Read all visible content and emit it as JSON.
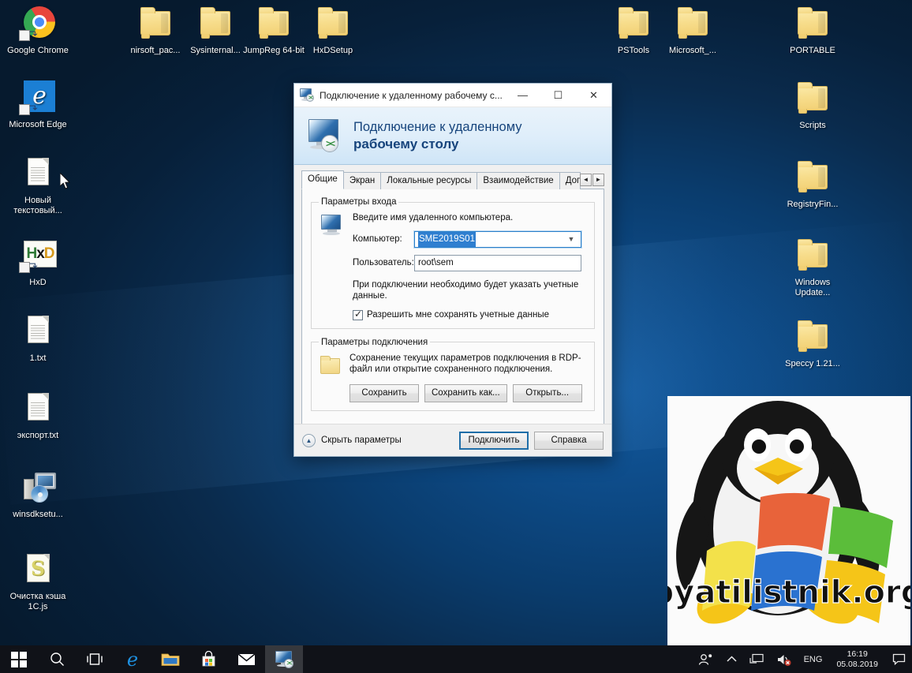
{
  "desktop": {
    "icons_left": [
      {
        "label": "Google Chrome",
        "type": "chrome",
        "shortcut": true
      },
      {
        "label": "Microsoft Edge",
        "type": "edge",
        "shortcut": true
      },
      {
        "label": "Новый текстовый...",
        "type": "doc",
        "shortcut": false
      },
      {
        "label": "HxD",
        "type": "hxd",
        "shortcut": true
      },
      {
        "label": "1.txt",
        "type": "doc",
        "shortcut": false
      },
      {
        "label": "экспорт.txt",
        "type": "doc",
        "shortcut": false
      },
      {
        "label": "winsdksetu...",
        "type": "sdk",
        "shortcut": false
      },
      {
        "label": "Очистка кэша 1C.js",
        "type": "js",
        "shortcut": false
      }
    ],
    "icons_top": [
      {
        "label": "nirsoft_pac...",
        "type": "folder"
      },
      {
        "label": "Sysinternal...",
        "type": "folder"
      },
      {
        "label": "JumpReg 64-bit",
        "type": "folder"
      },
      {
        "label": "HxDSetup",
        "type": "folder"
      },
      {
        "label": "PSTools",
        "type": "folder"
      },
      {
        "label": "Microsoft_...",
        "type": "folder"
      },
      {
        "label": "PORTABLE",
        "type": "folder"
      }
    ],
    "icons_right": [
      {
        "label": "Scripts",
        "type": "folder"
      },
      {
        "label": "RegistryFin...",
        "type": "folder"
      },
      {
        "label": "Windows Update...",
        "type": "folder"
      },
      {
        "label": "Speccy 1.21...",
        "type": "folder"
      }
    ],
    "watermark_text": "pyatilistnik.org"
  },
  "dialog": {
    "titlebar": {
      "title": "Подключение к удаленному рабочему с...",
      "minimize": "—",
      "maximize": "☐",
      "close": "✕"
    },
    "banner": {
      "line1": "Подключение к удаленному",
      "line2": "рабочему столу"
    },
    "tabs": [
      {
        "label": "Общие",
        "active": true
      },
      {
        "label": "Экран",
        "active": false
      },
      {
        "label": "Локальные ресурсы",
        "active": false
      },
      {
        "label": "Взаимодействие",
        "active": false
      },
      {
        "label": "Дополни",
        "active": false
      }
    ],
    "tab_scroll": {
      "left": "◄",
      "right": "►"
    },
    "logon_group": {
      "legend": "Параметры входа",
      "hint": "Введите имя удаленного компьютера.",
      "computer_label": "Компьютер:",
      "computer_value": "SME2019S01",
      "user_label": "Пользователь:",
      "user_value": "root\\sem",
      "credentials_note": "При подключении необходимо будет указать учетные данные.",
      "save_credentials_label": "Разрешить мне сохранять учетные данные",
      "save_credentials_checked": true
    },
    "connection_group": {
      "legend": "Параметры подключения",
      "description": "Сохранение текущих параметров подключения в RDP-файл или открытие сохраненного подключения.",
      "buttons": [
        "Сохранить",
        "Сохранить как...",
        "Открыть..."
      ]
    },
    "footer": {
      "hide_options": "Скрыть параметры",
      "connect": "Подключить",
      "help": "Справка"
    },
    "accent_color": "#1f6ea8",
    "selection_color": "#2f7fd0"
  },
  "taskbar": {
    "items": [
      {
        "name": "start",
        "label": "Пуск"
      },
      {
        "name": "search",
        "label": "Поиск"
      },
      {
        "name": "task-view",
        "label": "Представление задач"
      },
      {
        "name": "edge",
        "label": "Microsoft Edge"
      },
      {
        "name": "file-explorer",
        "label": "Проводник"
      },
      {
        "name": "store",
        "label": "Microsoft Store"
      },
      {
        "name": "mail",
        "label": "Почта"
      },
      {
        "name": "rdp",
        "label": "Подключение к удаленному рабочему столу"
      }
    ],
    "tray": {
      "people": "people-icon",
      "chevron": "^",
      "network": "network-icon",
      "volume": "volume-muted-icon",
      "language": "ENG",
      "time": "16:19",
      "date": "05.08.2019",
      "action_center": "notification-icon"
    }
  }
}
